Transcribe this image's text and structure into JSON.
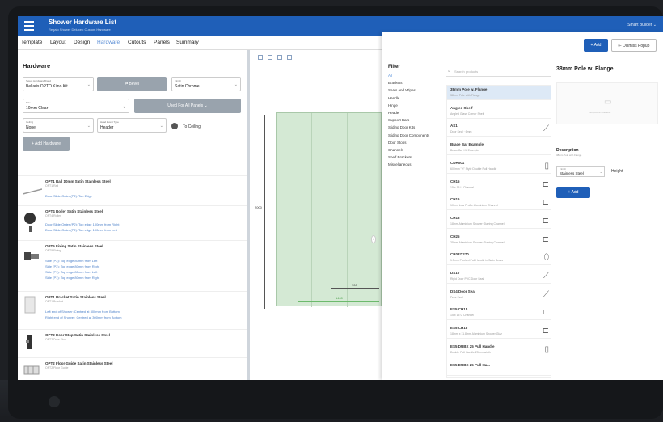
{
  "app": {
    "title": "Shower Hardware List",
    "subtitle": "Regalo Shower Deluxe • Custom Hardware",
    "user": "Smart Builder ⌄"
  },
  "tabs": [
    "Template",
    "Layout",
    "Design",
    "Hardware",
    "Cutouts",
    "Panels",
    "Summary"
  ],
  "active_tab": "Hardware",
  "hardware": {
    "title": "Hardware",
    "fields": {
      "brand": {
        "label": "Select Hardware Brand",
        "value": "Bellaris OPTO Kiino Kit"
      },
      "bevel_label": "⇄ Bevel",
      "finish": {
        "label": "Finish",
        "value": "Satin Chrome"
      },
      "size": {
        "label": "Size",
        "value": "10mm Clear"
      },
      "used_for_all": "Used For All Panels ⌄",
      "ceiling": {
        "label": "Ceiling",
        "value": "None"
      },
      "head_type": {
        "label": "Head Event Type",
        "value": "Header"
      },
      "to_ceiling": "To Ceiling",
      "add_button": "+ Add Hardware"
    },
    "items": [
      {
        "name": "OPT1 Rail 10mm Satin Stainless Steel",
        "code": "OPT1 Rail",
        "lines": [
          "Door-Slide-Outer (P2): Top Edge"
        ]
      },
      {
        "name": "OPT4 Roller Satin Stainless Steel",
        "code": "OPT4 Roller",
        "lines": [
          "Door-Slide-Outer (P2): Top edge 100mm from Right",
          "Door-Slide-Outer (P2): Top edge 100mm from Left"
        ]
      },
      {
        "name": "OPT5 Fixing Satin Stainless Steel",
        "code": "OPT5 Fixing",
        "lines": [
          "Side (P3): Top edge 80mm from Left",
          "Side (P3): Top edge 80mm from Right",
          "Side (P1): Top edge 80mm from Left",
          "Side (P1): Top edge 80mm from Right"
        ]
      },
      {
        "name": "OPT1 Bracket Satin Stainless Steel",
        "code": "OPT1 Bracket",
        "lines": [
          "Left end of Shower: Centred at 300mm from Bottom",
          "Right end of Shower: Centred at 300mm from Bottom"
        ]
      },
      {
        "name": "OPT2 Door Stop Satin Stainless Steel",
        "code": "OPT2 Door Stop",
        "lines": []
      },
      {
        "name": "OPT2 Floor Guide Satin Stainless Steel",
        "code": "OPT2 Floor Guide",
        "lines": []
      }
    ]
  },
  "canvas": {
    "height_label": "2000",
    "width_inner": "700",
    "width_outer": "1400"
  },
  "popup": {
    "add_label": "+ Add",
    "dismiss_label": "⇤ Dismiss Popup",
    "filter": {
      "title": "Filter",
      "items": [
        "All",
        "Brackets",
        "Seals and Wipes",
        "Handle",
        "Hinge",
        "Header",
        "Support Bars",
        "Sliding Door Kits",
        "Sliding Door Components",
        "Door Stops",
        "Channels",
        "Shelf Brackets",
        "Miscellaneous"
      ]
    },
    "search_placeholder": "Search products",
    "products": [
      {
        "name": "38mm Pole w. Flange",
        "desc": "38mm Pole with Flange",
        "icon": ""
      },
      {
        "name": "Angled Shelf",
        "desc": "Angled Glass Corner Shelf",
        "icon": ""
      },
      {
        "name": "AS1",
        "desc": "Door Seal · 6mm",
        "icon": "⟋"
      },
      {
        "name": "Brace Bar Example",
        "desc": "Brace Bar Kit Example",
        "icon": ""
      },
      {
        "name": "CDH001",
        "desc": "600mm \"H\" Style Double Pull Handle",
        "icon": "▯"
      },
      {
        "name": "CH15",
        "desc": "15 x 15 U Channel",
        "icon": "⊏"
      },
      {
        "name": "CH16",
        "desc": "10mm Low Profile Aluminium Channel",
        "icon": "⊏"
      },
      {
        "name": "CH18",
        "desc": "18mm Aluminium Shower Glazing Channel",
        "icon": "⊏"
      },
      {
        "name": "CH25",
        "desc": "25mm Aluminium Shower Glazing Channel",
        "icon": "⊏"
      },
      {
        "name": "CR037 270",
        "desc": "1.5mm Pushed Pull Handle in Satin Brass",
        "icon": "⬯"
      },
      {
        "name": "DS10",
        "desc": "Rigid Door PVC Door Seal",
        "icon": "⟋"
      },
      {
        "name": "DS4 Door Seal",
        "desc": "Door Seal",
        "icon": "⟋"
      },
      {
        "name": "ES5 CH15",
        "desc": "15 x 15 U Channel",
        "icon": "⊏"
      },
      {
        "name": "ES5 CH18",
        "desc": "18mm x 11.8mm Aluminium Shower Glaz",
        "icon": "⊏"
      },
      {
        "name": "ES5 DUBX 25 Pull Handle",
        "desc": "Double Pull Handle 25mm width",
        "icon": "▯"
      },
      {
        "name": "ES5 DUBX 25 Pull Ha...",
        "desc": "",
        "icon": ""
      }
    ],
    "detail": {
      "title": "38mm Pole w. Flange",
      "image_placeholder": "No picture available",
      "description_label": "Description",
      "description_sub": "38mm Pole with Flange",
      "finish_label": "Finish",
      "finish_value": "Stainless Steel",
      "height_label": "Height",
      "add_label": "+ Add"
    }
  }
}
